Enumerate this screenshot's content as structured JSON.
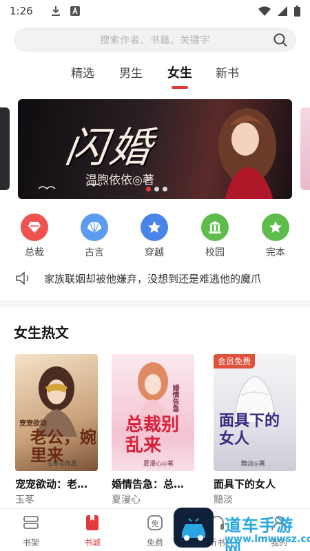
{
  "status_bar": {
    "time": "1:26"
  },
  "search": {
    "placeholder": "搜索作者、书籍、关键字"
  },
  "tabs": [
    {
      "label": "精选"
    },
    {
      "label": "男生"
    },
    {
      "label": "女生",
      "active": true
    },
    {
      "label": "新书"
    }
  ],
  "banner": {
    "title": "闪婚",
    "author": "温煦依依◎著",
    "slide_count": 3,
    "active_slide": 1
  },
  "categories": [
    {
      "label": "总裁",
      "icon": "crown-icon",
      "color": "#ef5350"
    },
    {
      "label": "古言",
      "icon": "fan-icon",
      "color": "#5c9cf0"
    },
    {
      "label": "穿越",
      "icon": "star-icon",
      "color": "#4a84e8"
    },
    {
      "label": "校园",
      "icon": "school-icon",
      "color": "#5cbd4a"
    },
    {
      "label": "完本",
      "icon": "star-icon",
      "color": "#5cbd4a"
    }
  ],
  "notice": {
    "text": "家族联姻却被他嫌弃，没想到还是难逃他的魔爪"
  },
  "section": {
    "title": "女生热文"
  },
  "books": [
    {
      "title": "宠宠欲动：老…",
      "author": "玉苳",
      "cover_title": "老公，婉里来",
      "cover_subtitle": "宠宠欲动",
      "cover_caption": "玉苳◎作品"
    },
    {
      "title": "婚情告急：总…",
      "author": "夏漫心",
      "cover_title": "总裁别乱来",
      "cover_subtitle": "婚情告急",
      "cover_caption": "夏漫心◎著"
    },
    {
      "title": "面具下的女人",
      "author": "黯淡",
      "cover_title": "面具下的女人",
      "cover_badge": "会员免费",
      "cover_caption": "黯淡◎著"
    }
  ],
  "bottom_nav": [
    {
      "label": "书架",
      "icon": "bookshelf-icon"
    },
    {
      "label": "书城",
      "icon": "bookstore-icon",
      "active": true
    },
    {
      "label": "免费",
      "icon": "free-icon"
    },
    {
      "label": "听书",
      "icon": "headphones-icon"
    },
    {
      "label": "我的",
      "icon": "profile-icon"
    }
  ],
  "watermark": {
    "title": "道车手游网",
    "url": "www.lmwwsz.com"
  },
  "colors": {
    "accent": "#e23a3a",
    "watermark": "#2aa7e0"
  }
}
